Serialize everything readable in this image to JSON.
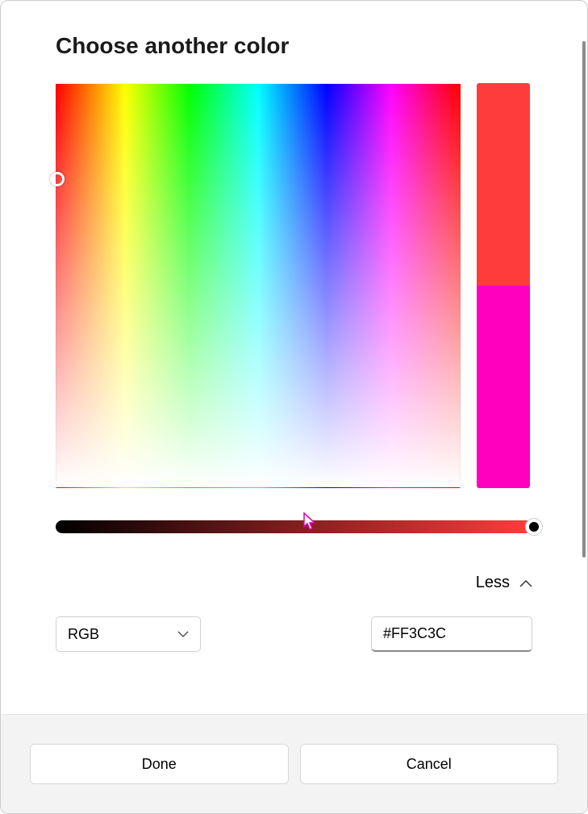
{
  "dialog": {
    "title": "Choose another color",
    "toggle_label": "Less",
    "mode_value": "RGB",
    "hex_value": "#FF3C3C",
    "done_label": "Done",
    "cancel_label": "Cancel"
  },
  "swatch": {
    "current_color": "#FF3C3C",
    "previous_color": "#FF00BF"
  },
  "slider": {
    "gradient_start": "#000000",
    "gradient_end": "#FF3C3C"
  }
}
